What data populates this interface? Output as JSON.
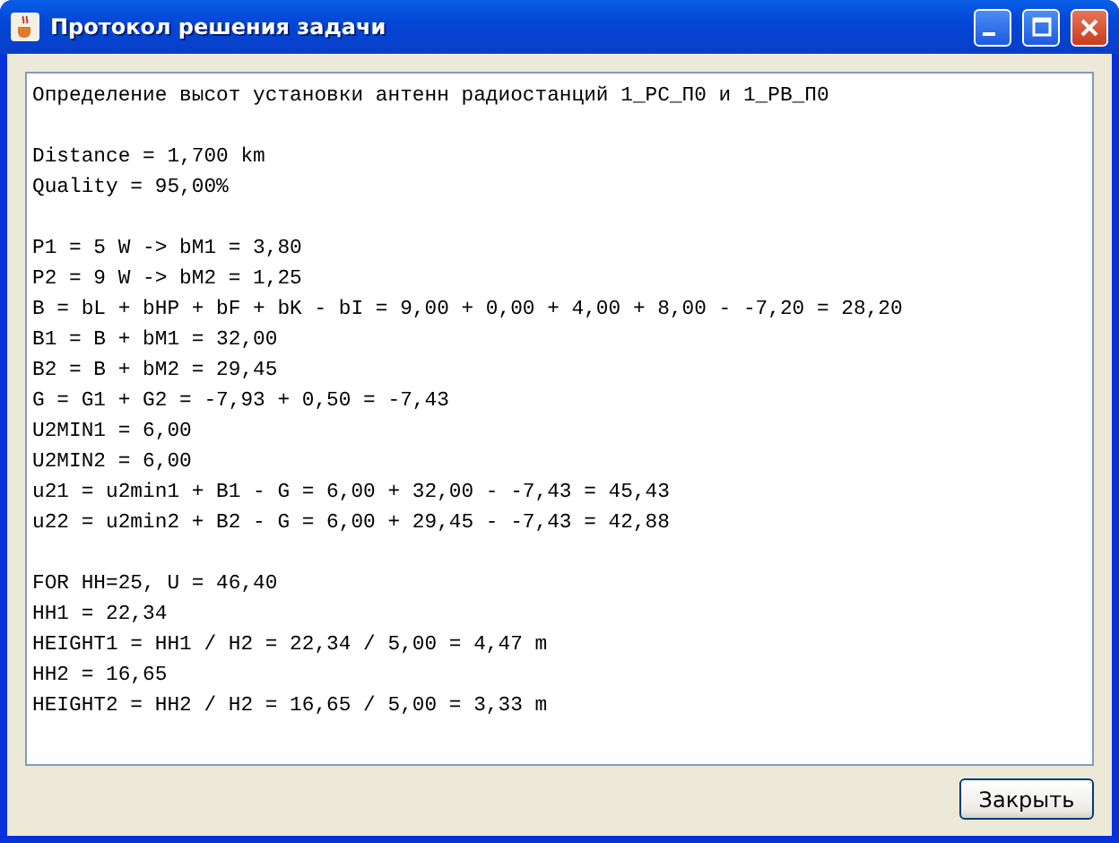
{
  "window": {
    "title": "Протокол решения задачи"
  },
  "report": {
    "paragraphs": [
      [
        "Определение высот установки антенн радиостанций 1_PC_П0 и 1_PB_П0"
      ],
      [
        "Distance = 1,700 km",
        "Quality = 95,00%"
      ],
      [
        "P1 = 5 W -> bM1 = 3,80",
        "P2 = 9 W -> bM2 = 1,25",
        "B = bL + bHP + bF + bK - bI = 9,00 + 0,00 + 4,00 + 8,00 - -7,20 = 28,20",
        "B1 = B + bM1 = 32,00",
        "B2 = B + bM2 = 29,45",
        "G = G1 + G2 = -7,93 + 0,50 = -7,43",
        "U2MIN1 = 6,00",
        "U2MIN2 = 6,00",
        "u21 = u2min1 + B1 - G = 6,00 + 32,00 - -7,43 = 45,43",
        "u22 = u2min2 + B2 - G = 6,00 + 29,45 - -7,43 = 42,88"
      ],
      [
        "FOR HH=25, U = 46,40",
        "HH1 = 22,34",
        "HEIGHT1 = HH1 / H2 = 22,34 / 5,00 = 4,47 m",
        "HH2 = 16,65",
        "HEIGHT2 = HH2 / H2 = 16,65 / 5,00 = 3,33 m"
      ]
    ]
  },
  "buttons": [
    {
      "label": "Закрыть"
    }
  ]
}
